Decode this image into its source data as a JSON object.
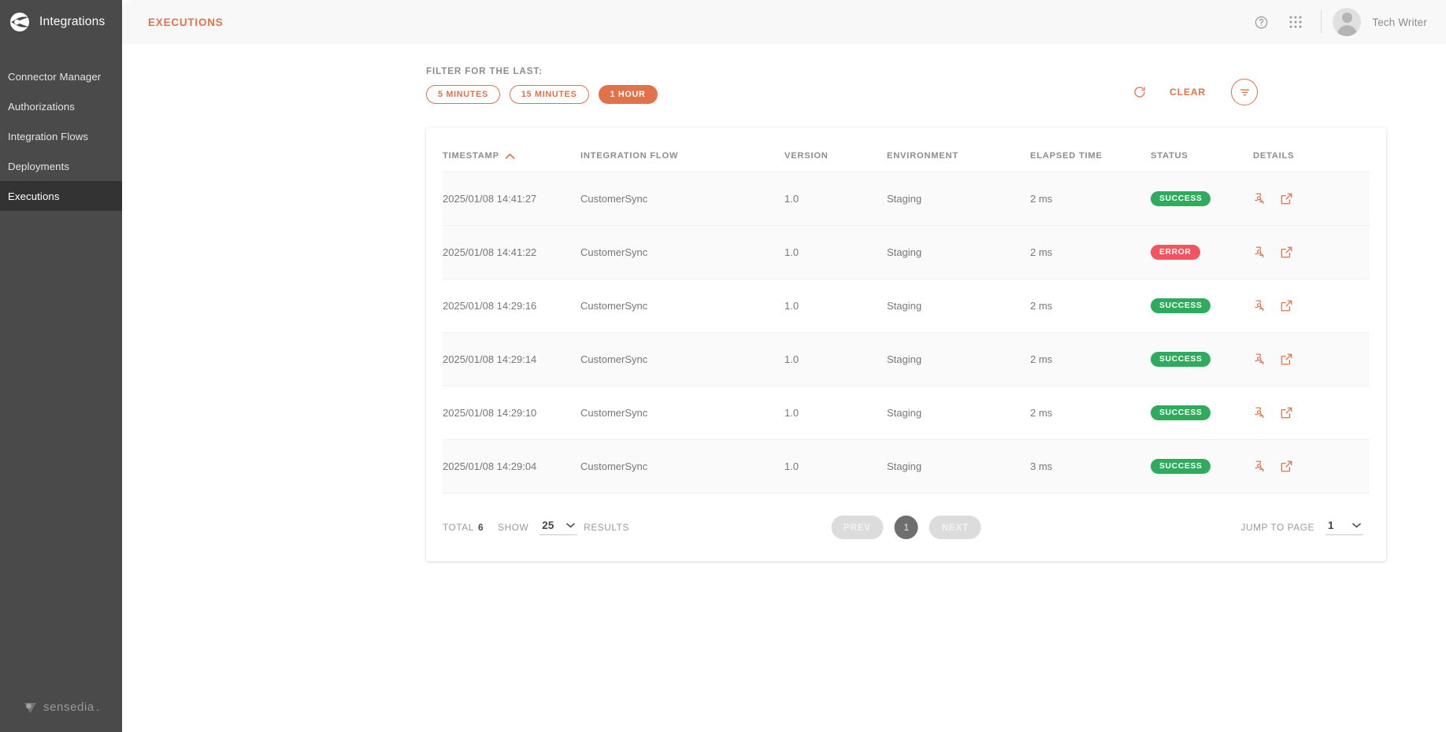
{
  "sidebar": {
    "brand": {
      "name": "Integrations",
      "logo_icon": "sensedia-integrations-logo"
    },
    "items": [
      {
        "label": "Connector Manager",
        "active": false
      },
      {
        "label": "Authorizations",
        "active": false
      },
      {
        "label": "Integration Flows",
        "active": false
      },
      {
        "label": "Deployments",
        "active": false
      },
      {
        "label": "Executions",
        "active": true
      }
    ],
    "footer": {
      "brand": "sensedia",
      "dot": "."
    }
  },
  "topbar": {
    "title": "EXECUTIONS",
    "help_icon": "help-circle-icon",
    "apps_icon": "apps-grid-icon",
    "user_name": "Tech Writer",
    "avatar_icon": "user-avatar"
  },
  "filters": {
    "label": "FILTER FOR THE LAST:",
    "chips": [
      {
        "label": "5 MINUTES",
        "active": false
      },
      {
        "label": "15 MINUTES",
        "active": false
      },
      {
        "label": "1 HOUR",
        "active": true
      }
    ],
    "refresh_icon": "refresh-icon",
    "clear_label": "CLEAR",
    "funnel_icon": "filter-funnel-icon"
  },
  "table": {
    "columns": [
      {
        "label": "TIMESTAMP",
        "sorted": true,
        "sort_dir": "asc"
      },
      {
        "label": "INTEGRATION FLOW",
        "sorted": false
      },
      {
        "label": "VERSION",
        "sorted": false
      },
      {
        "label": "ENVIRONMENT",
        "sorted": false
      },
      {
        "label": "ELAPSED TIME",
        "sorted": false
      },
      {
        "label": "STATUS",
        "sorted": false
      },
      {
        "label": "DETAILS",
        "sorted": false
      }
    ],
    "rows": [
      {
        "timestamp": "2025/01/08 14:41:27",
        "flow": "CustomerSync",
        "version": "1.0",
        "environment": "Staging",
        "elapsed": "2 ms",
        "status": "SUCCESS",
        "status_kind": "success"
      },
      {
        "timestamp": "2025/01/08 14:41:22",
        "flow": "CustomerSync",
        "version": "1.0",
        "environment": "Staging",
        "elapsed": "2 ms",
        "status": "ERROR",
        "status_kind": "error"
      },
      {
        "timestamp": "2025/01/08 14:29:16",
        "flow": "CustomerSync",
        "version": "1.0",
        "environment": "Staging",
        "elapsed": "2 ms",
        "status": "SUCCESS",
        "status_kind": "success"
      },
      {
        "timestamp": "2025/01/08 14:29:14",
        "flow": "CustomerSync",
        "version": "1.0",
        "environment": "Staging",
        "elapsed": "2 ms",
        "status": "SUCCESS",
        "status_kind": "success"
      },
      {
        "timestamp": "2025/01/08 14:29:10",
        "flow": "CustomerSync",
        "version": "1.0",
        "environment": "Staging",
        "elapsed": "2 ms",
        "status": "SUCCESS",
        "status_kind": "success"
      },
      {
        "timestamp": "2025/01/08 14:29:04",
        "flow": "CustomerSync",
        "version": "1.0",
        "environment": "Staging",
        "elapsed": "3 ms",
        "status": "SUCCESS",
        "status_kind": "success"
      }
    ],
    "row_icons": {
      "trace_icon": "execution-trace-icon",
      "open_icon": "open-external-icon"
    }
  },
  "footer": {
    "total_label": "TOTAL",
    "total_value": "6",
    "show_label": "SHOW",
    "page_size": "25",
    "results_label": "RESULTS",
    "prev_label": "PREV",
    "current_page": "1",
    "next_label": "NEXT",
    "jump_label": "JUMP TO PAGE",
    "jump_value": "1"
  },
  "colors": {
    "accent": "#e1724a",
    "sidebar": "#4a4a4a",
    "sidebar_active": "#333333",
    "success": "#2eab5d",
    "error": "#f5535f",
    "page_bg": "#ffffff",
    "topbar_bg": "#f8f8f8"
  }
}
